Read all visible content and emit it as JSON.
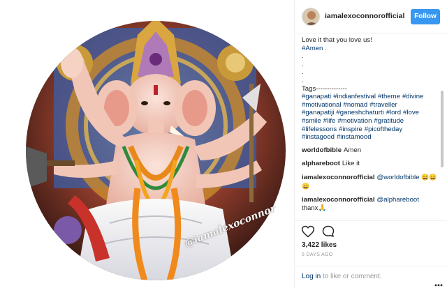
{
  "post": {
    "watermark": "@iamalexoconnor"
  },
  "header": {
    "username": "iamalexoconnorofficial",
    "follow_label": "Follow"
  },
  "caption": {
    "line1": "Love it that you love us!",
    "line2": "#Amen .",
    "dots": [
      ".",
      ".",
      ".",
      "."
    ],
    "tags_label": "Tags--------------",
    "hashtags": [
      "#ganapati",
      "#indianfestival",
      "#theme",
      "#divine",
      "#motivational",
      "#nomad",
      "#traveller",
      "#ganapatiji",
      "#ganeshchaturti",
      "#lord",
      "#love",
      "#smile",
      "#life",
      "#motivation",
      "#gratitude",
      "#lifelessons",
      "#inspire",
      "#picoftheday",
      "#instagood",
      "#instamood"
    ]
  },
  "comments": [
    {
      "user": "worldofbible",
      "text": "Amen"
    },
    {
      "user": "alphareboot",
      "text": "Like it"
    },
    {
      "user": "iamalexoconnorofficial",
      "mention": "@worldofbible",
      "text": "😀😀😀"
    },
    {
      "user": "iamalexoconnorofficial",
      "mention": "@alphareboot",
      "text": "thanx🙏"
    }
  ],
  "stats": {
    "likes": "3,422 likes",
    "timestamp": "5 DAYS AGO"
  },
  "login": {
    "link": "Log in",
    "rest": " to like or comment."
  },
  "icons": {
    "like": "heart-icon",
    "comment": "comment-icon",
    "more": "more-options-icon"
  },
  "colors": {
    "follow_button": "#3897f0",
    "link": "#003569",
    "muted": "#999999"
  }
}
